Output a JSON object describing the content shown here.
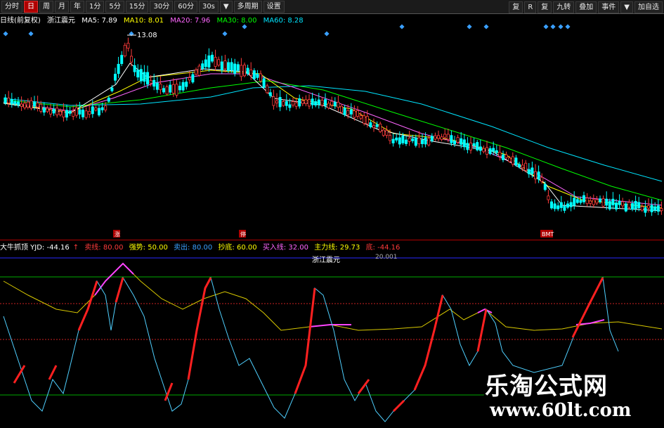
{
  "toolbar": {
    "left": [
      "分时",
      "日",
      "周",
      "月",
      "年",
      "1分",
      "5分",
      "15分",
      "30分",
      "60分",
      "30s",
      "▼",
      "多周期",
      "设置"
    ],
    "active_index": 1,
    "right": [
      "复",
      "R",
      "复",
      "九转",
      "叠加",
      "事件",
      "▼",
      "加自选"
    ]
  },
  "ma_legend": {
    "period": "日线(前复权)",
    "name": "浙江震元",
    "ma5": "MA5: 7.89",
    "ma10": "MA10: 8.01",
    "ma20": "MA20: 7.96",
    "ma30": "MA30: 8.00",
    "ma60": "MA60: 8.28"
  },
  "price_annotation": "13.08",
  "signals": {
    "a": "涨",
    "b": "停",
    "c": "BMT"
  },
  "indicator_legend": {
    "name": "大牛抓顶 YJD: -44.16",
    "mark": "↑",
    "items": [
      "卖线: 80.00",
      "强势: 50.00",
      "卖出: 80.00",
      "抄底: 60.00",
      "买入线: 32.00",
      "主力线: 29.73",
      "底: -44.16"
    ]
  },
  "indicator_subtitle": "浙江震元",
  "indicator_value": "20.001",
  "watermark": {
    "cn": "乐淘公式网",
    "url": "www.60lt.com"
  },
  "colors": {
    "bull": "#ff3b3b",
    "bear": "#00ffff",
    "ma5": "#ffffff",
    "ma10": "#ffff00",
    "ma20": "#ff66ff",
    "ma30": "#00ff00",
    "ma60": "#00e5ff"
  }
}
